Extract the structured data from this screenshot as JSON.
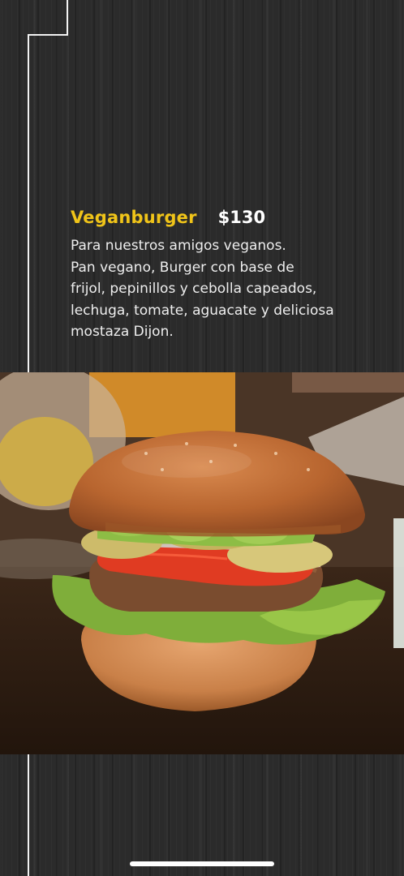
{
  "menu_item": {
    "name": "Veganburger",
    "price": "$130",
    "description_lines": [
      "Para nuestros amigos veganos.",
      "Pan vegano, Burger con base de",
      "frijol, pepinillos y cebolla capeados,",
      "lechuga, tomate, aguacate y deliciosa",
      "mostaza Dijon."
    ]
  },
  "photo": {
    "icon": "veganburger-photo"
  },
  "colors": {
    "accent": "#f0c419",
    "background": "#2b2b2b",
    "text": "#eeeeee"
  }
}
